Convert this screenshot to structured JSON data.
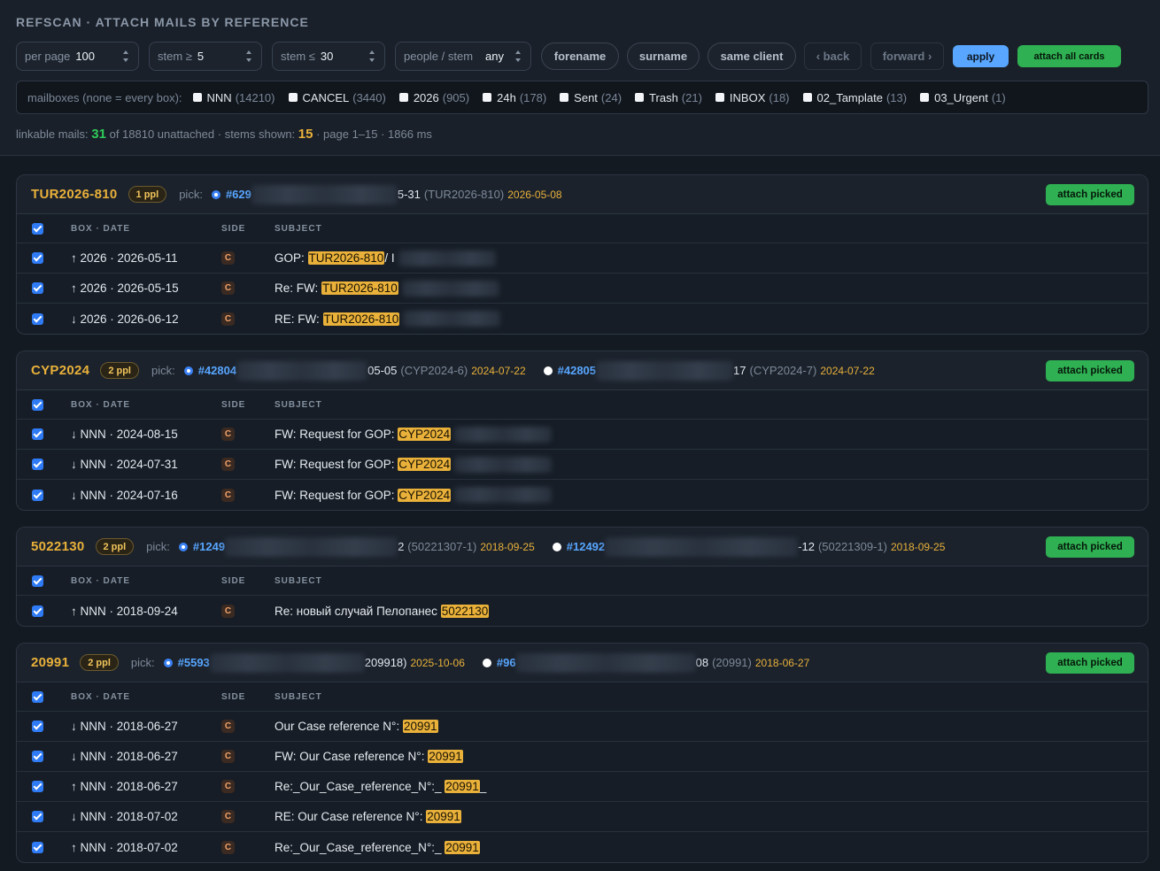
{
  "app": {
    "title": "REFSCAN · ATTACH MAILS BY REFERENCE"
  },
  "controls": {
    "per_page": {
      "label": "per page",
      "value": "100"
    },
    "stem_min": {
      "label": "stem ≥",
      "value": "5"
    },
    "stem_max": {
      "label": "stem ≤",
      "value": "30"
    },
    "people_stem": {
      "label": "people / stem",
      "value": "any"
    },
    "forename": "forename",
    "surname": "surname",
    "same_client": "same client",
    "back": "‹ back",
    "forward": "forward ›",
    "apply": "apply",
    "attach_all": "attach all cards"
  },
  "mailboxes": {
    "label": "mailboxes (none = every box):",
    "items": [
      {
        "name": "NNN",
        "count": "(14210)"
      },
      {
        "name": "CANCEL",
        "count": "(3440)"
      },
      {
        "name": "2026",
        "count": "(905)"
      },
      {
        "name": "24h",
        "count": "(178)"
      },
      {
        "name": "Sent",
        "count": "(24)"
      },
      {
        "name": "Trash",
        "count": "(21)"
      },
      {
        "name": "INBOX",
        "count": "(18)"
      },
      {
        "name": "02_Tamplate",
        "count": "(13)"
      },
      {
        "name": "03_Urgent",
        "count": "(1)"
      }
    ]
  },
  "stats": {
    "linkable_label": "linkable mails:",
    "linkable": "31",
    "of_text": "of 18810 unattached · stems shown:",
    "stems": "15",
    "tail": "· page 1–15 · 1866 ms"
  },
  "table_headers": {
    "box_date": "BOX · DATE",
    "side": "SIDE",
    "subject": "SUBJECT"
  },
  "cards": [
    {
      "ref": "TUR2026-810",
      "ppl": "1 ppl",
      "pick_label": "pick:",
      "attach_label": "attach picked",
      "picks": [
        {
          "id": "#629",
          "tail": "5-31",
          "ref": "(TUR2026-810)",
          "date": "2026-05-08"
        }
      ],
      "rows": [
        {
          "box": "↑ 2026 · 2026-05-11",
          "side": "C",
          "pre": "GOP: ",
          "hl": "TUR2026-810",
          "post": "/ I"
        },
        {
          "box": "↑ 2026 · 2026-05-15",
          "side": "C",
          "pre": "Re: FW: ",
          "hl": "TUR2026-810",
          "post": ""
        },
        {
          "box": "↓ 2026 · 2026-06-12",
          "side": "C",
          "pre": "RE: FW: ",
          "hl": "TUR2026-810",
          "post": ""
        }
      ]
    },
    {
      "ref": "CYP2024",
      "ppl": "2 ppl",
      "pick_label": "pick:",
      "attach_label": "attach picked",
      "picks": [
        {
          "id": "#42804",
          "tail": "05-05",
          "ref": "(CYP2024-6)",
          "date": "2024-07-22"
        },
        {
          "id": "#42805",
          "tail": "17",
          "ref": "(CYP2024-7)",
          "date": "2024-07-22"
        }
      ],
      "rows": [
        {
          "box": "↓ NNN · 2024-08-15",
          "side": "C",
          "pre": "FW: Request for GOP: ",
          "hl": "CYP2024",
          "post": ""
        },
        {
          "box": "↓ NNN · 2024-07-31",
          "side": "C",
          "pre": "FW: Request for GOP: ",
          "hl": "CYP2024",
          "post": ""
        },
        {
          "box": "↓ NNN · 2024-07-16",
          "side": "C",
          "pre": "FW: Request for GOP: ",
          "hl": "CYP2024",
          "post": ""
        }
      ]
    },
    {
      "ref": "5022130",
      "ppl": "2 ppl",
      "pick_label": "pick:",
      "attach_label": "attach picked",
      "picks": [
        {
          "id": "#1249",
          "tail": "2",
          "ref": "(50221307-1)",
          "date": "2018-09-25"
        },
        {
          "id": "#12492",
          "tail": "-12",
          "ref": "(50221309-1)",
          "date": "2018-09-25"
        }
      ],
      "rows": [
        {
          "box": "↑ NNN · 2018-09-24",
          "side": "C",
          "pre": "Re: новый случай Пелопанес ",
          "hl": "5022130",
          "post": ""
        }
      ]
    },
    {
      "ref": "20991",
      "ppl": "2 ppl",
      "pick_label": "pick:",
      "attach_label": "attach picked",
      "picks": [
        {
          "id": "#5593",
          "tail": "209918)",
          "ref": "",
          "date": "2025-10-06"
        },
        {
          "id": "#96",
          "tail": "08",
          "ref": "(20991)",
          "date": "2018-06-27"
        }
      ],
      "rows": [
        {
          "box": "↓ NNN · 2018-06-27",
          "side": "C",
          "pre": "Our Case reference N°: ",
          "hl": "20991",
          "post": ""
        },
        {
          "box": "↓ NNN · 2018-06-27",
          "side": "C",
          "pre": "FW: Our Case reference N°: ",
          "hl": "20991",
          "post": ""
        },
        {
          "box": "↑ NNN · 2018-06-27",
          "side": "C",
          "pre": "Re:_Our_Case_reference_N°:_ ",
          "hl": "20991",
          "post": "_"
        },
        {
          "box": "↓ NNN · 2018-07-02",
          "side": "C",
          "pre": "RE: Our Case reference N°: ",
          "hl": "20991",
          "post": ""
        },
        {
          "box": "↑ NNN · 2018-07-02",
          "side": "C",
          "pre": "Re:_Our_Case_reference_N°:_ ",
          "hl": "20991",
          "post": ""
        }
      ]
    }
  ]
}
